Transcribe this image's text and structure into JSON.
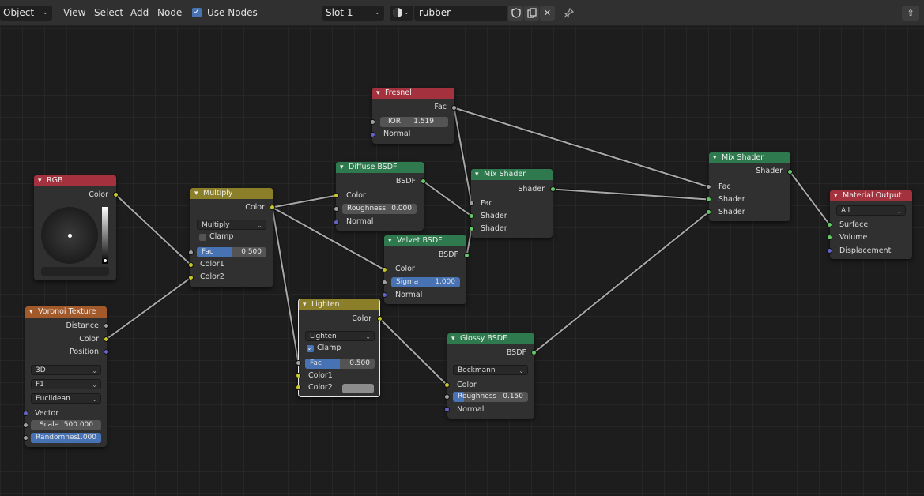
{
  "header": {
    "mode": "Object",
    "menus": [
      "View",
      "Select",
      "Add",
      "Node"
    ],
    "use_nodes_label": "Use Nodes",
    "use_nodes_checked": true,
    "slot": "Slot 1",
    "material_name": "rubber",
    "icons": [
      "shield-icon",
      "copy-icon",
      "close-icon",
      "pin-icon",
      "sphere-icon",
      "parent-icon"
    ]
  },
  "colors": {
    "input_header": "#a4313e",
    "color_header": "#8c7f29",
    "shader_header": "#2e7a4e",
    "texture_header": "#a25a2a",
    "slider_fill": "#4772b3",
    "socket_color": "#c7c729",
    "socket_shader": "#63c763",
    "socket_vector": "#6363c7"
  },
  "nodes": {
    "rgb": {
      "title": "RGB",
      "out_color": "Color"
    },
    "voronoi": {
      "title": "Voronoi Texture",
      "out_distance": "Distance",
      "out_color": "Color",
      "out_position": "Position",
      "dims": "3D",
      "feature": "F1",
      "metric": "Euclidean",
      "in_vector": "Vector",
      "scale_label": "Scale",
      "scale_value": "500.000",
      "random_label": "Randomnes",
      "random_value": "1.000",
      "random_fraction": 1.0
    },
    "multiply": {
      "title": "Multiply",
      "out_color": "Color",
      "blend": "Multiply",
      "clamp": "Clamp",
      "clamp_checked": false,
      "fac_label": "Fac",
      "fac_value": "0.500",
      "fac_fraction": 0.5,
      "in_color1": "Color1",
      "in_color2": "Color2"
    },
    "lighten": {
      "title": "Lighten",
      "out_color": "Color",
      "blend": "Lighten",
      "clamp": "Clamp",
      "clamp_checked": true,
      "fac_label": "Fac",
      "fac_value": "0.500",
      "fac_fraction": 0.5,
      "in_color1": "Color1",
      "in_color2": "Color2"
    },
    "fresnel": {
      "title": "Fresnel",
      "out_fac": "Fac",
      "ior_label": "IOR",
      "ior_value": "1.519",
      "in_normal": "Normal"
    },
    "diffuse": {
      "title": "Diffuse BSDF",
      "out_bsdf": "BSDF",
      "in_color": "Color",
      "rough_label": "Roughness",
      "rough_value": "0.000",
      "in_normal": "Normal"
    },
    "velvet": {
      "title": "Velvet BSDF",
      "out_bsdf": "BSDF",
      "in_color": "Color",
      "sigma_label": "Sigma",
      "sigma_value": "1.000",
      "sigma_fraction": 1.0,
      "in_normal": "Normal"
    },
    "glossy": {
      "title": "Glossy BSDF",
      "out_bsdf": "BSDF",
      "distribution": "Beckmann",
      "in_color": "Color",
      "rough_label": "Roughness",
      "rough_value": "0.150",
      "rough_fraction": 0.15,
      "in_normal": "Normal"
    },
    "mix1": {
      "title": "Mix Shader",
      "out_shader": "Shader",
      "in_fac": "Fac",
      "in_shader1": "Shader",
      "in_shader2": "Shader"
    },
    "mix2": {
      "title": "Mix Shader",
      "out_shader": "Shader",
      "in_fac": "Fac",
      "in_shader1": "Shader",
      "in_shader2": "Shader"
    },
    "output": {
      "title": "Material Output",
      "target": "All",
      "in_surface": "Surface",
      "in_volume": "Volume",
      "in_displacement": "Displacement"
    }
  }
}
